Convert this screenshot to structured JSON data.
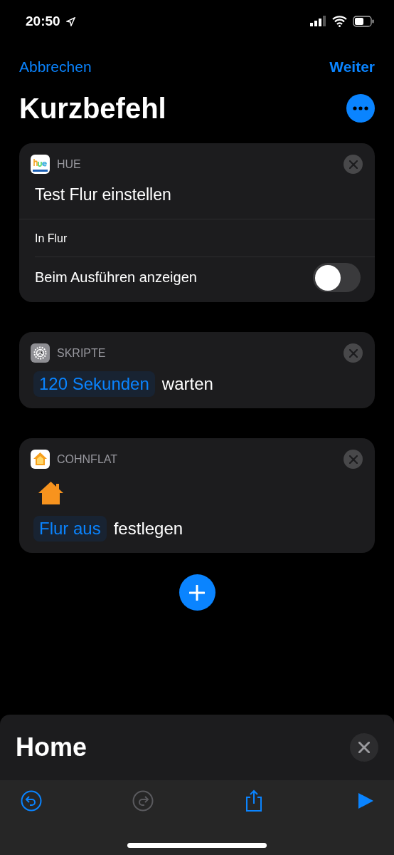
{
  "status_bar": {
    "time": "20:50"
  },
  "nav": {
    "cancel": "Abbrechen",
    "next": "Weiter"
  },
  "title": "Kurzbefehl",
  "actions": [
    {
      "kind": "setting",
      "app": "HUE",
      "title": "Test Flur einstellen",
      "detail": "In Flur",
      "option": {
        "label": "Beim Ausführen anzeigen",
        "on": false
      }
    },
    {
      "kind": "phrase",
      "app": "SKRIPTE",
      "token": "120 Sekunden",
      "text": "warten"
    },
    {
      "kind": "home",
      "app": "COHNFLAT",
      "token": "Flur aus",
      "text": "festlegen"
    }
  ],
  "sheet": {
    "title": "Home"
  },
  "toolbar": [
    {
      "kind": "undo",
      "disabled": false
    },
    {
      "kind": "redo",
      "disabled": true
    },
    {
      "kind": "share",
      "disabled": false
    },
    {
      "kind": "run",
      "disabled": false
    }
  ]
}
